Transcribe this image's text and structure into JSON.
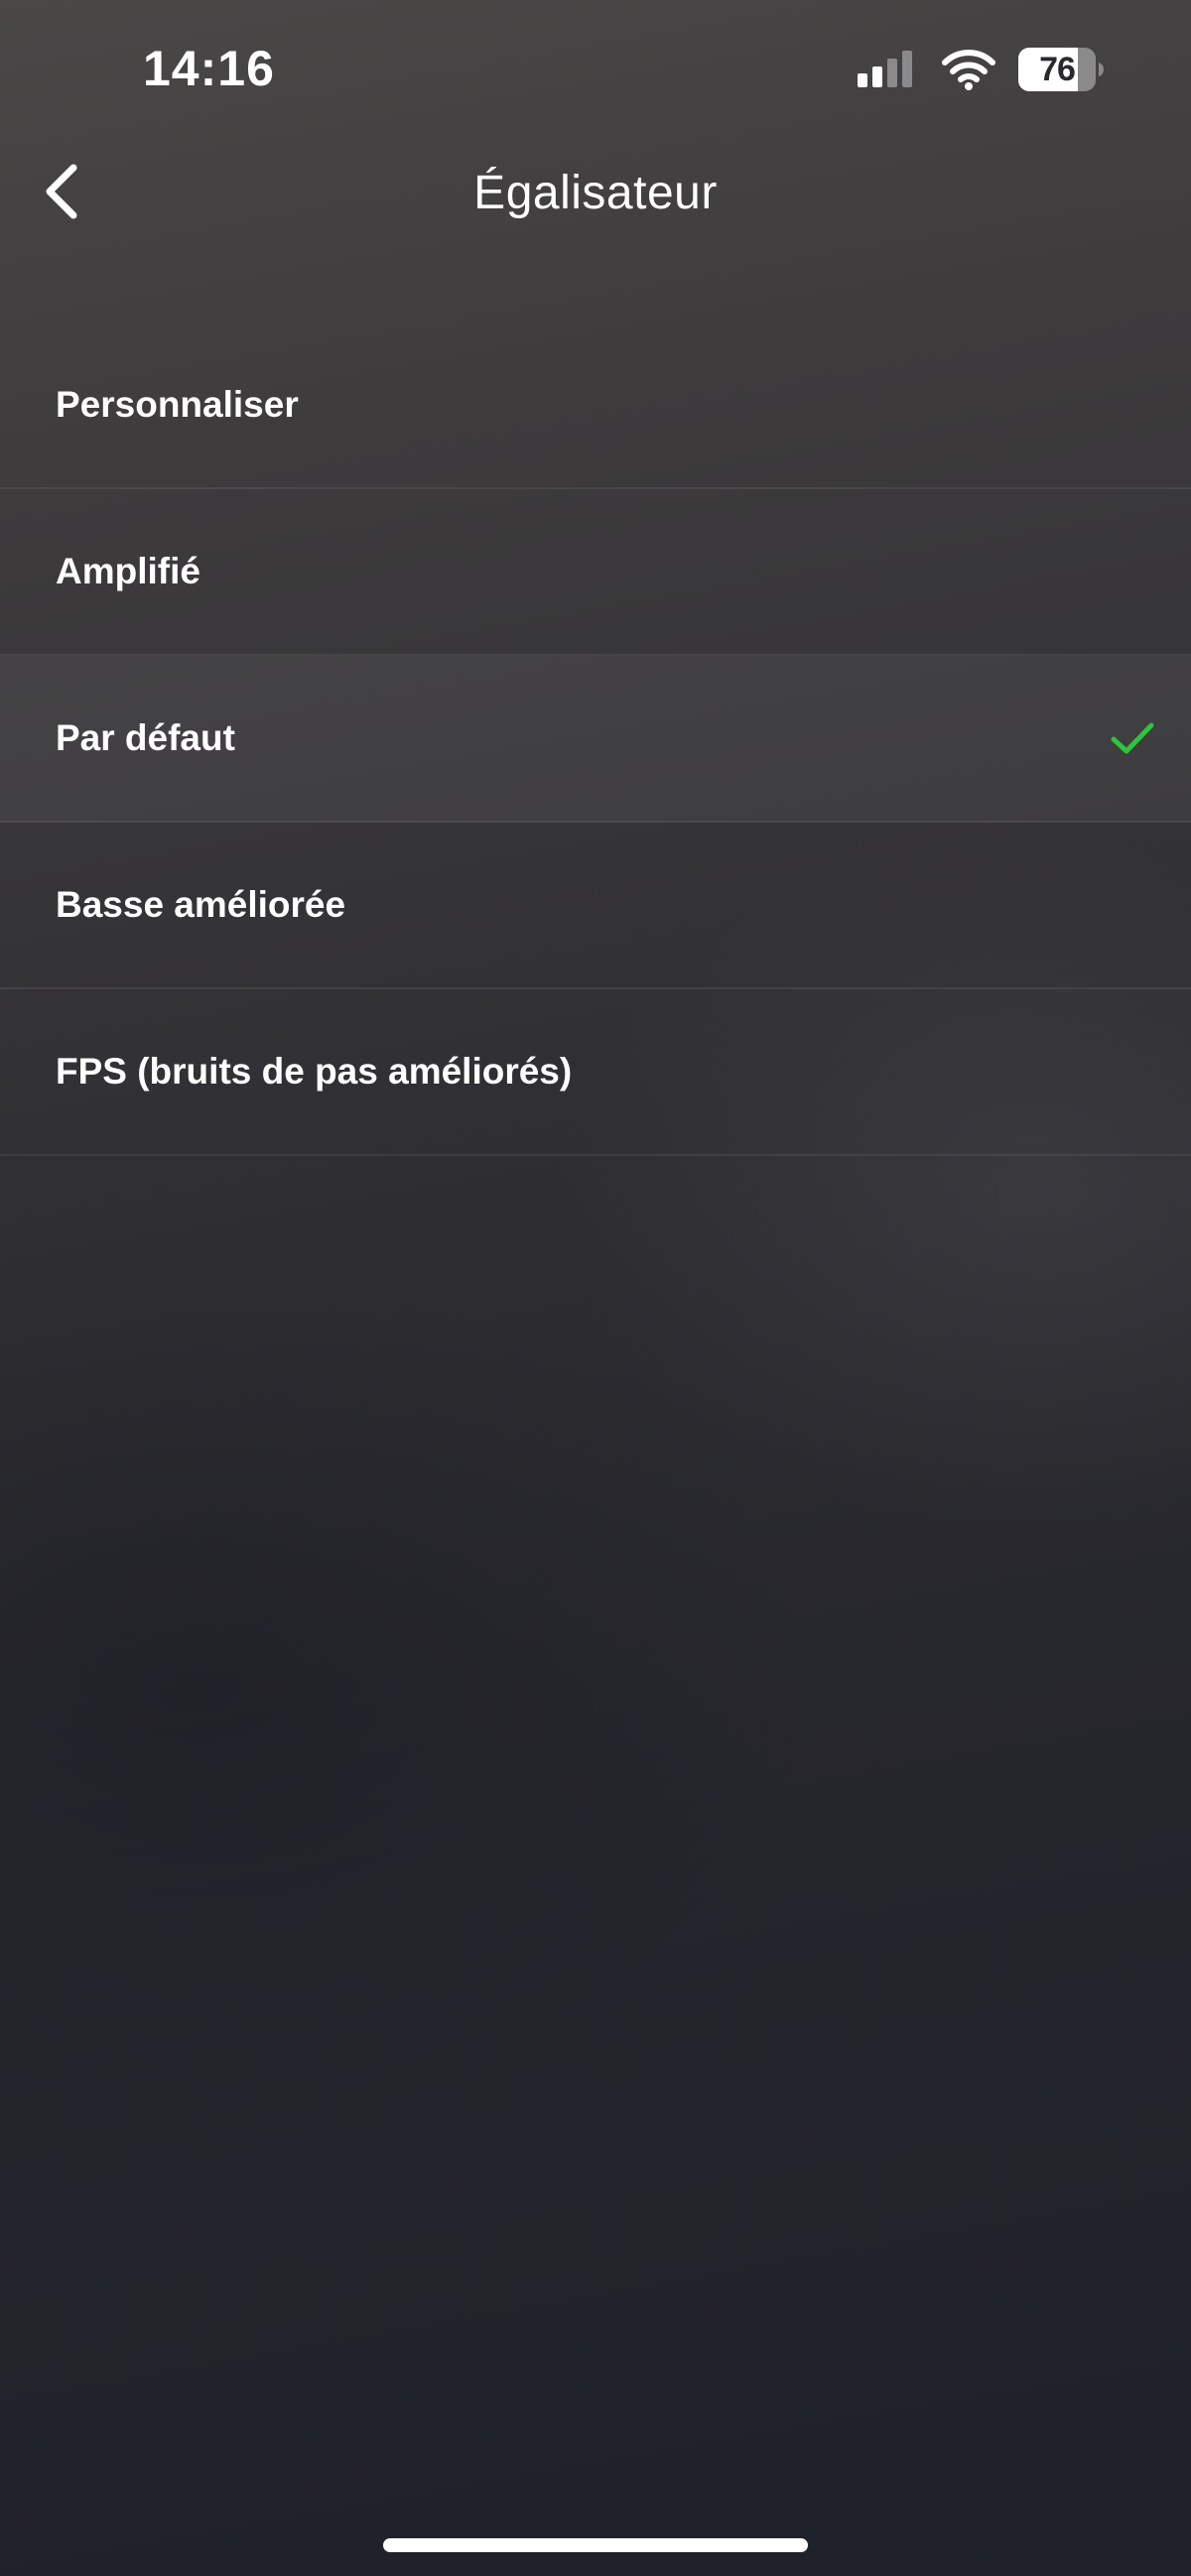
{
  "status_bar": {
    "time": "14:16",
    "battery_level": "76",
    "icons": [
      "signal-icon",
      "wifi-icon",
      "battery-icon"
    ]
  },
  "header": {
    "title": "Égalisateur",
    "back_icon": "chevron-left-icon"
  },
  "options": [
    {
      "label": "Personnaliser",
      "selected": false
    },
    {
      "label": "Amplifié",
      "selected": false
    },
    {
      "label": "Par défaut",
      "selected": true
    },
    {
      "label": "Basse améliorée",
      "selected": false
    },
    {
      "label": "FPS (bruits de pas améliorés)",
      "selected": false
    }
  ],
  "colors": {
    "accent_check": "#2ec43b",
    "text": "#ffffff"
  }
}
